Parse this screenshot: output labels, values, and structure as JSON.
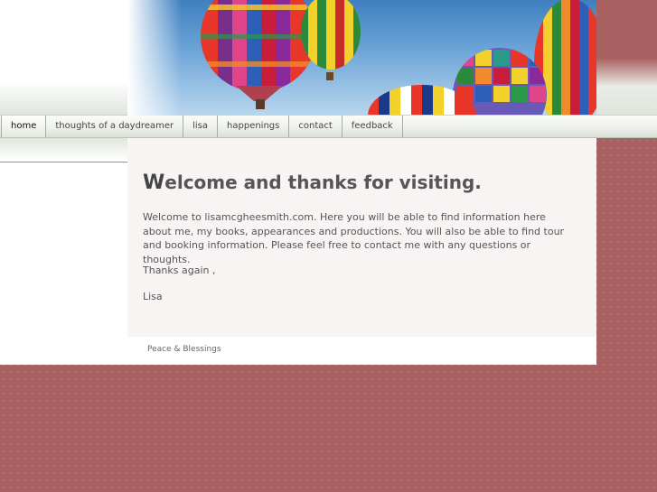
{
  "nav": {
    "items": [
      {
        "label": "home"
      },
      {
        "label": "thoughts of a daydreamer"
      },
      {
        "label": "lisa"
      },
      {
        "label": "happenings"
      },
      {
        "label": "contact"
      },
      {
        "label": "feedback"
      }
    ]
  },
  "main": {
    "title_cap": "W",
    "title_rest": "elcome and thanks for visiting.",
    "intro": "Welcome to lisamcgheesmith.com.  Here you will be able to find information here about me, my books, appearances and productions. You will also be able to find tour and booking information.  Please feel free to contact me with any questions or thoughts.",
    "thanks": "Thanks again ,",
    "signature": "Lisa"
  },
  "footer": {
    "text": "Peace & Blessings"
  },
  "colors": {
    "background": "#a86060",
    "content_bg": "#f7f4f3",
    "nav_bg": "#eef1ec",
    "text": "#555555"
  }
}
